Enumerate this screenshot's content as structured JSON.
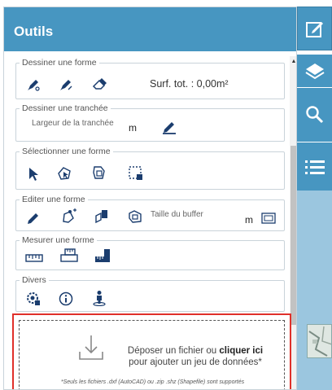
{
  "panel": {
    "title": "Outils"
  },
  "groups": {
    "draw_shape": {
      "legend": "Dessiner une forme",
      "surface_label": "Surf. tot. : 0,00m²",
      "tools": [
        "draw-polygon-icon",
        "draw-line-icon",
        "eraser-icon"
      ]
    },
    "draw_trench": {
      "legend": "Dessiner une tranchée",
      "width_placeholder": "Largeur de la tranchée",
      "unit": "m",
      "tools": [
        "pencil-icon"
      ]
    },
    "select_shape": {
      "legend": "Sélectionner une forme",
      "tools": [
        "pointer-icon",
        "select-polygon-icon",
        "select-shape-icon",
        "select-box-icon"
      ]
    },
    "edit_shape": {
      "legend": "Editer une forme",
      "buffer_placeholder": "Taille du buffer",
      "unit": "m",
      "tools": [
        "pencil-icon",
        "edit-vertices-icon",
        "extrude-icon",
        "buffer-icon",
        "buffer-toggle-icon"
      ]
    },
    "measure_shape": {
      "legend": "Mesurer une forme",
      "tools": [
        "ruler-length-icon",
        "ruler-area-icon",
        "ruler-angle-icon"
      ]
    },
    "misc": {
      "legend": "Divers",
      "tools": [
        "settings-icon",
        "info-icon",
        "person-location-icon"
      ]
    }
  },
  "upload": {
    "line1": "Déposer un fichier ou",
    "link": "cliquer ici",
    "line2": "pour ajouter un jeu de données*",
    "note": "*Seuls les fichiers .dxf (AutoCAD) ou .zip .shz (Shapefile) sont supportés"
  },
  "side_tabs": [
    "edit-icon",
    "layers-icon",
    "search-icon",
    "list-icon"
  ],
  "colors": {
    "header": "#4796c1",
    "tab_light": "#9bc6df",
    "icon_dark": "#1b3d6e",
    "upload_border": "#e0302a"
  }
}
